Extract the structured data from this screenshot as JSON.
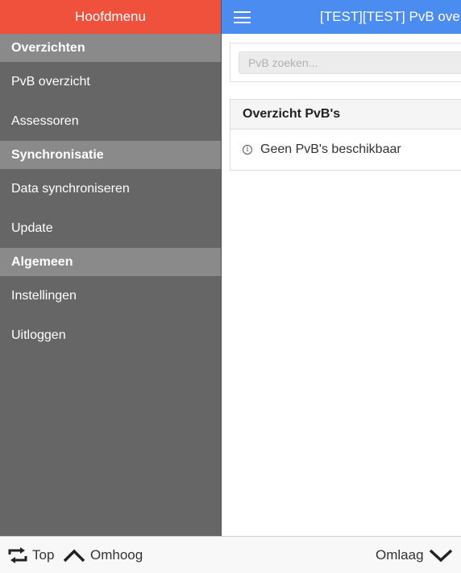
{
  "sidebar": {
    "title": "Hoofdmenu",
    "sections": [
      {
        "label": "Overzichten",
        "items": [
          "PvB overzicht",
          "Assessoren"
        ]
      },
      {
        "label": "Synchronisatie",
        "items": [
          "Data synchroniseren",
          "Update"
        ]
      },
      {
        "label": "Algemeen",
        "items": [
          "Instellingen",
          "Uitloggen"
        ]
      }
    ]
  },
  "topbar": {
    "title": "[TEST][TEST] PvB overzicht",
    "menu_icon": "hamburger-icon"
  },
  "search": {
    "placeholder": "PvB zoeken...",
    "value": ""
  },
  "list": {
    "header": "Overzicht PvB's",
    "empty_text": "Geen PvB's beschikbaar",
    "empty_icon": "info-icon"
  },
  "footer": {
    "top_label": "Top",
    "up_label": "Omhoog",
    "down_label": "Omlaag",
    "icons": [
      "return-top-icon",
      "chevron-up-icon",
      "chevron-down-icon"
    ]
  },
  "colors": {
    "sidebar_header": "#f0513d",
    "topbar": "#4a8cf0",
    "sidebar_bg": "#666666",
    "section_bg": "#8a8a8a"
  }
}
